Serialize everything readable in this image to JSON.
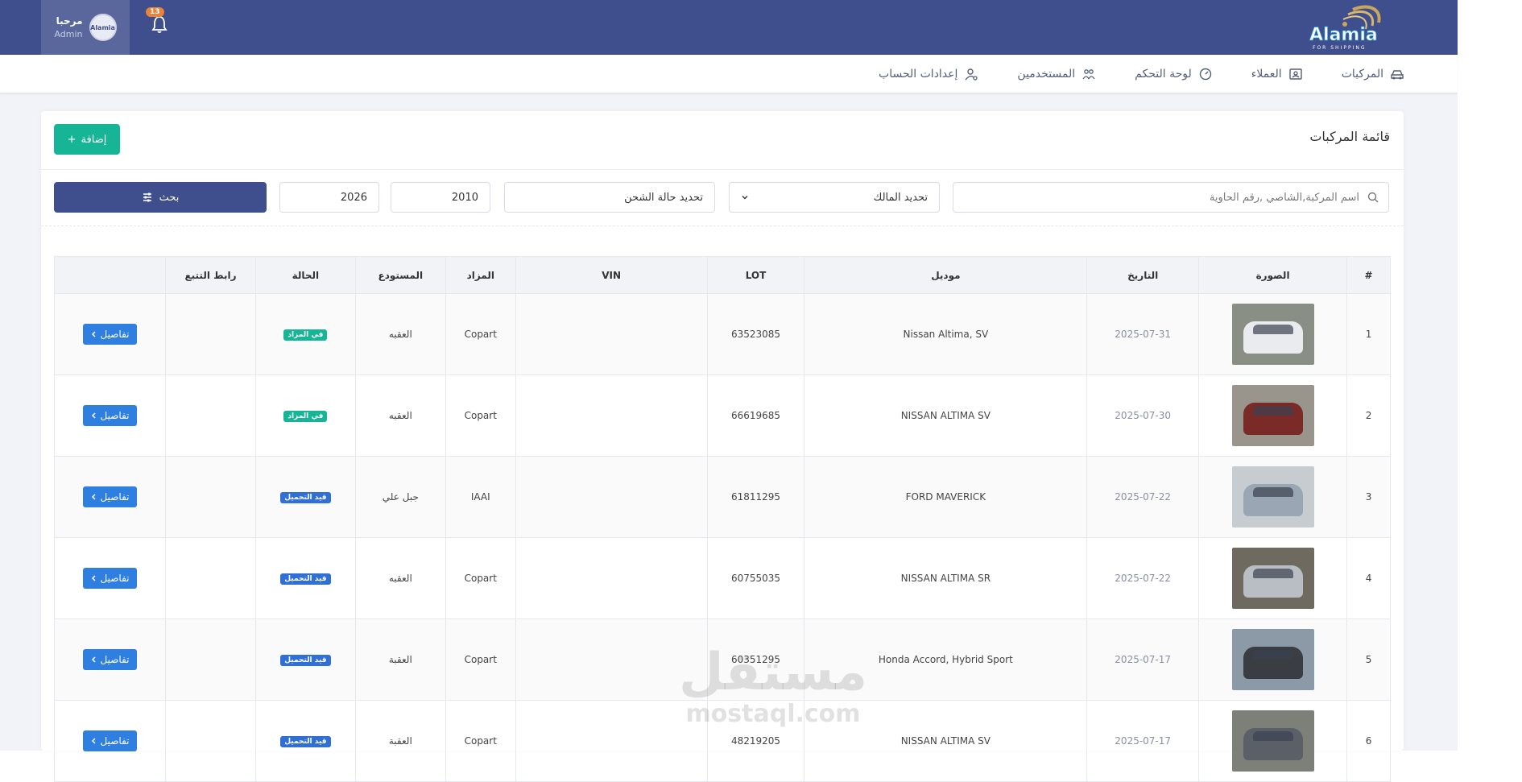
{
  "brand": {
    "logo_text": "Alamia",
    "logo_sub": "FOR SHIPPING"
  },
  "header": {
    "notification_count": "13",
    "user": {
      "greeting": "مرحبا",
      "role": "Admin",
      "avatar_text": "Alamia"
    }
  },
  "nav": {
    "items": [
      {
        "label": "المركبات",
        "icon": "car-icon"
      },
      {
        "label": "العملاء",
        "icon": "customers-icon"
      },
      {
        "label": "لوحة التحكم",
        "icon": "dashboard-icon"
      },
      {
        "label": "المستخدمين",
        "icon": "users-icon"
      },
      {
        "label": "إعدادات الحساب",
        "icon": "account-settings-icon"
      }
    ]
  },
  "page": {
    "title": "قائمة المركبات",
    "add_label": "إضافة",
    "add_symbol": "+"
  },
  "filters": {
    "search_placeholder": "اسم المركبة,الشاصي ,رقم الحاوية",
    "owner_label": "تحديد المالك",
    "status_label": "تحديد حالة الشحن",
    "year_from": "2010",
    "year_to": "2026",
    "search_label": "بحث"
  },
  "table": {
    "headers": {
      "index": "#",
      "image": "الصورة",
      "date": "التاريخ",
      "model": "موديل",
      "lot": "LOT",
      "vin": "VIN",
      "auction": "المزاد",
      "warehouse": "المستودع",
      "status": "الحالة",
      "tracking": "رابط التتبع"
    },
    "details_label": "تفاصيل",
    "rows": [
      {
        "index": "1",
        "date": "2025-07-31",
        "model": "Nissan Altima, SV",
        "lot": "63523085",
        "vin": "",
        "auction": "Copart",
        "warehouse": "العقبه",
        "status": "في المزاد",
        "status_color": "#16b595",
        "tracking": "",
        "car_color": "#e9ebee",
        "bg_color": "#8a8f86"
      },
      {
        "index": "2",
        "date": "2025-07-30",
        "model": "NISSAN ALTIMA SV",
        "lot": "66619685",
        "vin": "",
        "auction": "Copart",
        "warehouse": "العقبه",
        "status": "في المزاد",
        "status_color": "#16b595",
        "tracking": "",
        "car_color": "#7a2b28",
        "bg_color": "#9a958c"
      },
      {
        "index": "3",
        "date": "2025-07-22",
        "model": "FORD MAVERICK",
        "lot": "61811295",
        "vin": "",
        "auction": "IAAI",
        "warehouse": "جبل علي",
        "status": "قيد التحميل",
        "status_color": "#2f6fd6",
        "tracking": "",
        "car_color": "#9aa6b3",
        "bg_color": "#c7ccd1"
      },
      {
        "index": "4",
        "date": "2025-07-22",
        "model": "NISSAN ALTIMA SR",
        "lot": "60755035",
        "vin": "",
        "auction": "Copart",
        "warehouse": "العقبه",
        "status": "قيد التحميل",
        "status_color": "#2f6fd6",
        "tracking": "",
        "car_color": "#b9bec4",
        "bg_color": "#6f6a60"
      },
      {
        "index": "5",
        "date": "2025-07-17",
        "model": "Honda Accord, Hybrid Sport",
        "lot": "60351295",
        "vin": "",
        "auction": "Copart",
        "warehouse": "العقبة",
        "status": "قيد التحميل",
        "status_color": "#2f6fd6",
        "tracking": "",
        "car_color": "#3a3d42",
        "bg_color": "#8c9aa8"
      },
      {
        "index": "6",
        "date": "2025-07-17",
        "model": "NISSAN ALTIMA SV",
        "lot": "48219205",
        "vin": "",
        "auction": "Copart",
        "warehouse": "العقبة",
        "status": "قيد التحميل",
        "status_color": "#2f6fd6",
        "tracking": "",
        "car_color": "#5b6068",
        "bg_color": "#7d8078"
      }
    ]
  },
  "watermark": {
    "arabic": "مستقل",
    "latin": "mostaql.com"
  }
}
